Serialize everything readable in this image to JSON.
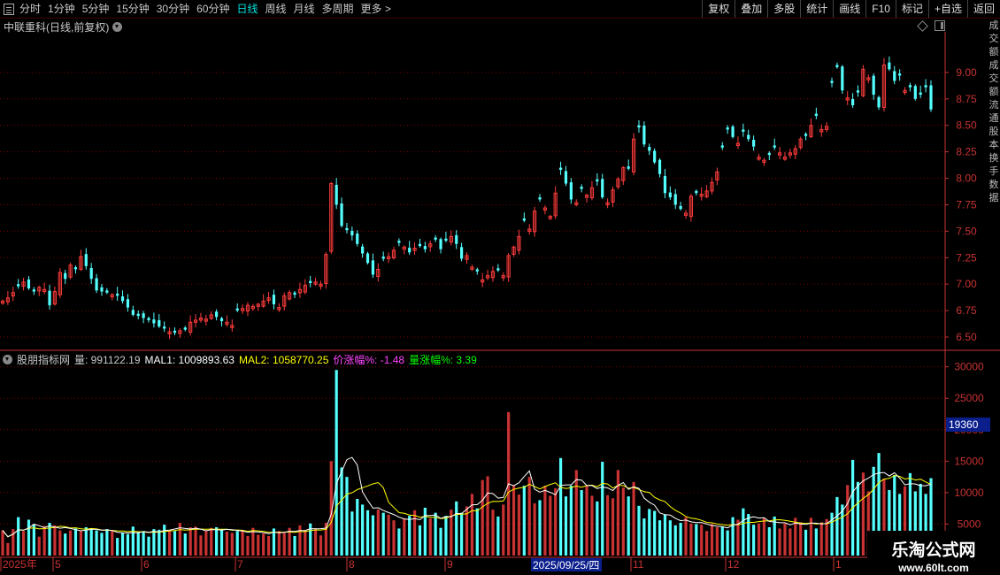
{
  "toolbar": {
    "periods": [
      "分时",
      "1分钟",
      "5分钟",
      "15分钟",
      "30分钟",
      "60分钟",
      "日线",
      "周线",
      "月线",
      "多周期",
      "更多 >"
    ],
    "active_period": "日线",
    "right_buttons": [
      "复权",
      "叠加",
      "多股",
      "统计",
      "画线",
      "F10",
      "标记",
      "+自选",
      "返回"
    ]
  },
  "stock": {
    "name": "中联重科",
    "mode": "(日线,前复权)"
  },
  "price_axis": [
    "9.00",
    "8.75",
    "8.50",
    "8.25",
    "8.00",
    "7.75",
    "7.50",
    "7.25",
    "7.00",
    "6.75",
    "6.50"
  ],
  "volume_axis": [
    "30000",
    "25000",
    "20000",
    "15000",
    "10000",
    "5000"
  ],
  "volume_highlight": "19360",
  "indicator": {
    "name": "股朋指标网",
    "vol_label": "量: 991122.19",
    "mal1_label": "MAL1: 1009893.63",
    "mal2_label": "MAL2: 1058770.25",
    "pct_label": "价涨幅%: -1.48",
    "vol_pct_label": "量涨幅%: 3.39"
  },
  "date_axis": {
    "year_label": "2025年",
    "months": [
      "5",
      "6",
      "7",
      "8",
      "9",
      "11",
      "12",
      "1"
    ],
    "cursor_date": "2025/09/25/四"
  },
  "right_strip_text": [
    "成",
    "交",
    "额",
    "成",
    "交",
    "额",
    "流",
    "通",
    "股",
    "本",
    "换",
    "手",
    "数",
    "据"
  ],
  "watermark": {
    "title": "乐淘公式网",
    "url": "www.60lt.com"
  },
  "colors": {
    "up": "#ff3c3c",
    "down": "#54ffff",
    "ma1": "#ffffff",
    "ma2": "#ffff00",
    "axis": "#c83232",
    "grid": "#7a0000",
    "active": "#00e0e0",
    "mal1": "#ffffff",
    "mal2": "#ffff00",
    "pct": "#ff44ff",
    "vol_pct": "#00ff00"
  },
  "chart_data": {
    "type": "candlestick+volume",
    "price_range": [
      6.4,
      9.35
    ],
    "volume_range": [
      0,
      31500
    ],
    "closes": [
      6.84,
      6.87,
      6.92,
      6.98,
      7.02,
      6.96,
      6.93,
      6.97,
      6.95,
      6.8,
      6.93,
      7.11,
      7.05,
      7.18,
      7.14,
      7.26,
      7.17,
      7.05,
      6.94,
      6.93,
      6.92,
      6.9,
      6.89,
      6.84,
      6.78,
      6.71,
      6.7,
      6.68,
      6.66,
      6.63,
      6.6,
      6.58,
      6.55,
      6.54,
      6.56,
      6.57,
      6.64,
      6.66,
      6.68,
      6.67,
      6.71,
      6.69,
      6.65,
      6.64,
      6.61,
      6.75,
      6.77,
      6.8,
      6.79,
      6.81,
      6.84,
      6.87,
      6.81,
      6.78,
      6.89,
      6.92,
      6.9,
      6.95,
      6.99,
      7.01,
      7.02,
      7.0,
      7.28,
      7.95,
      7.75,
      7.55,
      7.51,
      7.46,
      7.38,
      7.29,
      7.2,
      7.09,
      7.14,
      7.24,
      7.26,
      7.32,
      7.39,
      7.35,
      7.3,
      7.34,
      7.36,
      7.33,
      7.38,
      7.42,
      7.33,
      7.41,
      7.45,
      7.38,
      7.24,
      7.27,
      7.16,
      7.12,
      7.04,
      7.08,
      7.12,
      7.13,
      7.08,
      7.27,
      7.35,
      7.45,
      7.6,
      7.52,
      7.69,
      7.8,
      7.72,
      7.64,
      7.86,
      8.08,
      7.95,
      7.8,
      7.77,
      7.9,
      7.84,
      7.91,
      7.97,
      7.82,
      7.77,
      7.89,
      7.99,
      8.1,
      8.09,
      8.37,
      8.48,
      8.32,
      8.26,
      8.15,
      8.04,
      7.86,
      7.82,
      7.75,
      7.71,
      7.67,
      7.83,
      7.86,
      7.85,
      7.88,
      7.96,
      8.06,
      8.29,
      8.46,
      8.39,
      8.33,
      8.44,
      8.37,
      8.3,
      8.2,
      8.17,
      8.22,
      8.29,
      8.24,
      8.2,
      8.24,
      8.28,
      8.37,
      8.4,
      8.5,
      8.59,
      8.46,
      8.49,
      8.9,
      9.05,
      8.83,
      8.76,
      8.69,
      8.81,
      9.03,
      8.95,
      8.79,
      8.67,
      9.07,
      9.03,
      8.92,
      8.97,
      8.83,
      8.86,
      8.75,
      8.79,
      8.86,
      8.65
    ],
    "volumes": [
      4000,
      2000,
      4200,
      6100,
      3900,
      5700,
      5000,
      3000,
      4700,
      5200,
      4800,
      4000,
      3500,
      4000,
      4300,
      3900,
      4500,
      4100,
      4000,
      3600,
      4200,
      3900,
      2800,
      3600,
      3400,
      4600,
      3700,
      3800,
      3000,
      4200,
      4100,
      4900,
      4000,
      3900,
      5200,
      3500,
      4500,
      4600,
      3200,
      3900,
      4400,
      4500,
      4200,
      3800,
      3600,
      3900,
      4000,
      3100,
      4400,
      3300,
      3500,
      3100,
      4300,
      3900,
      3600,
      4400,
      3100,
      4800,
      4000,
      5100,
      4300,
      3200,
      5200,
      15000,
      29500,
      14000,
      12500,
      7000,
      9000,
      8100,
      7200,
      6400,
      7300,
      6800,
      6500,
      5600,
      4300,
      5900,
      6300,
      7200,
      4800,
      7600,
      5900,
      6800,
      4400,
      6300,
      7300,
      8600,
      6800,
      7800,
      9800,
      7500,
      12000,
      12600,
      7300,
      6200,
      8100,
      22800,
      11100,
      9700,
      11100,
      12500,
      8300,
      8800,
      11100,
      9500,
      10700,
      15500,
      9400,
      11100,
      13600,
      10400,
      11100,
      9500,
      8600,
      14900,
      9600,
      9100,
      13600,
      10800,
      9400,
      11700,
      7900,
      5900,
      7400,
      7100,
      5600,
      6500,
      5600,
      4800,
      5200,
      6100,
      5100,
      5000,
      4900,
      3900,
      5000,
      4500,
      4600,
      4000,
      6100,
      5700,
      7500,
      6600,
      4900,
      5100,
      6000,
      4500,
      6200,
      4300,
      5100,
      4300,
      6000,
      5300,
      4100,
      6000,
      4300,
      5300,
      5800,
      6800,
      9300,
      8100,
      11200,
      15200,
      11700,
      13200,
      10200,
      14100,
      16300,
      12200,
      10400,
      12800,
      9800,
      11000,
      13100,
      10200,
      11400,
      9800,
      12300,
      9900,
      10900,
      11900,
      10300
    ],
    "candle_colors": [
      "up",
      "up",
      "up",
      "down",
      "up",
      "down",
      "down",
      "up",
      "up",
      "down",
      "up",
      "up",
      "down",
      "up",
      "down",
      "up",
      "down",
      "down",
      "down",
      "down",
      "down",
      "up",
      "down",
      "down",
      "down",
      "down",
      "down",
      "down",
      "down",
      "down",
      "down",
      "down",
      "up",
      "down",
      "up",
      "down",
      "up",
      "up",
      "up",
      "up",
      "up",
      "down",
      "down",
      "up",
      "up",
      "down",
      "up",
      "up",
      "up",
      "up",
      "up",
      "up",
      "down",
      "up",
      "up",
      "up",
      "down",
      "up",
      "up",
      "down",
      "up",
      "up",
      "up",
      "up",
      "down",
      "down",
      "down",
      "down",
      "down",
      "down",
      "down",
      "down",
      "up",
      "down",
      "up",
      "up",
      "down",
      "up",
      "down",
      "up",
      "down",
      "down",
      "up",
      "down",
      "down",
      "down",
      "up",
      "down",
      "down",
      "up",
      "up",
      "down",
      "up",
      "up",
      "up",
      "down",
      "up",
      "up",
      "up",
      "up",
      "down",
      "up",
      "up",
      "down",
      "up",
      "up",
      "up",
      "down",
      "down",
      "down",
      "up",
      "down",
      "up",
      "up",
      "down",
      "down",
      "up",
      "up",
      "up",
      "up",
      "down",
      "up",
      "down",
      "down",
      "down",
      "down",
      "down",
      "down",
      "down",
      "down",
      "down",
      "up",
      "up",
      "down",
      "up",
      "up",
      "up",
      "up",
      "down",
      "down",
      "down",
      "up",
      "down",
      "down",
      "down",
      "up",
      "up",
      "down",
      "down",
      "up",
      "up",
      "up",
      "up",
      "up",
      "down",
      "up",
      "down",
      "up",
      "up",
      "down",
      "down",
      "down",
      "up",
      "down",
      "down",
      "up",
      "up",
      "down",
      "down",
      "up",
      "down",
      "down",
      "down",
      "up",
      "down",
      "down"
    ]
  }
}
